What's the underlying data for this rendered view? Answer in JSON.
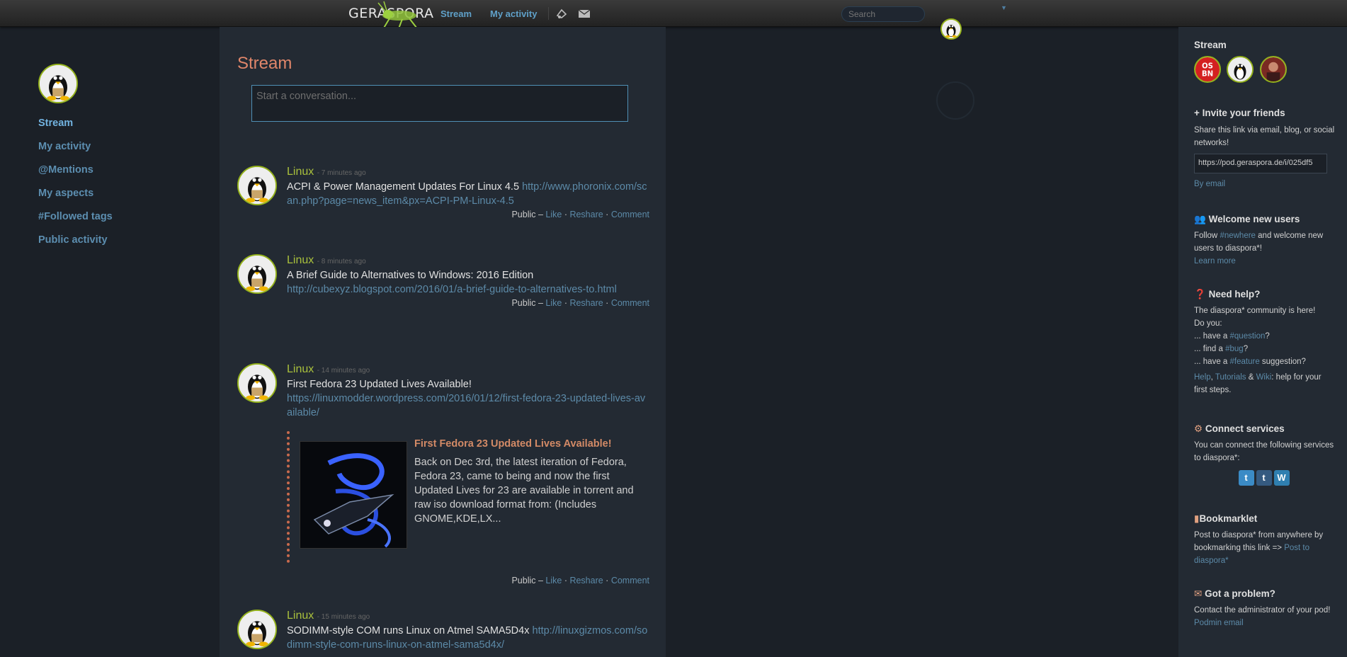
{
  "header": {
    "logo_text": "GERASPORA",
    "nav_stream": "Stream",
    "nav_activity": "My activity",
    "search_placeholder": "Search",
    "icons": [
      "notifications-icon",
      "messages-icon",
      "user-menu-caret-icon"
    ]
  },
  "left_nav": {
    "items": [
      {
        "label": "Stream",
        "active": true
      },
      {
        "label": "My activity"
      },
      {
        "label": "@Mentions"
      },
      {
        "label": "My aspects"
      },
      {
        "label": "#Followed tags"
      },
      {
        "label": "Public activity"
      }
    ]
  },
  "main": {
    "title": "Stream",
    "publisher_placeholder": "Start a conversation...",
    "posts": [
      {
        "author": "Linux",
        "time": "- 7 minutes ago",
        "text": "ACPI & Power Management Updates For Linux 4.5",
        "link": "http://www.phoronix.com/scan.php?page=news_item&px=ACPI-PM-Linux-4.5",
        "visibility": "Public",
        "like": "Like",
        "reshare": "Reshare",
        "comment": "Comment"
      },
      {
        "author": "Linux",
        "time": "- 8 minutes ago",
        "text": "A Brief Guide to Alternatives to Windows: 2016 Edition",
        "link": "http://cubexyz.blogspot.com/2016/01/a-brief-guide-to-alternatives-to.html",
        "visibility": "Public",
        "like": "Like",
        "reshare": "Reshare",
        "comment": "Comment"
      },
      {
        "author": "Linux",
        "time": "- 14 minutes ago",
        "text": "First Fedora 23 Updated Lives Available!",
        "link": "https://linuxmodder.wordpress.com/2016/01/12/first-fedora-23-updated-lives-available/",
        "embed_title": "First Fedora 23 Updated Lives Available!",
        "embed_desc": "Back on Dec 3rd, the latest iteration of Fedora, Fedora 23, came to being and now the first  Updated Lives for 23  are  available in torrent and raw iso download format from: (Includes GNOME,KDE,LX...",
        "visibility": "Public",
        "like": "Like",
        "reshare": "Reshare",
        "comment": "Comment"
      },
      {
        "author": "Linux",
        "time": "- 15 minutes ago",
        "text": "SODIMM-style COM runs Linux on Atmel SAMA5D4x",
        "link": "http://linuxgizmos.com/sodimm-style-com-runs-linux-on-atmel-sama5d4x/"
      }
    ]
  },
  "right": {
    "stream_heading": "Stream",
    "invite_heading": "+ Invite your friends",
    "invite_text": "Share this link via email, blog, or social networks!",
    "invite_link": "https://pod.geraspora.de/i/025df5",
    "by_email": "By email",
    "welcome_heading": "Welcome new users",
    "welcome_text_1": "Follow ",
    "welcome_tag": "#newhere",
    "welcome_text_2": " and welcome new users to diaspora*!",
    "learn_more": "Learn more",
    "help_heading": "Need help?",
    "help_line1": "The diaspora* community is here!",
    "help_line2": "Do you:",
    "help_q_pre": "... have a ",
    "help_q_tag": "#question",
    "help_q_post": "?",
    "help_b_pre": "... find a ",
    "help_b_tag": "#bug",
    "help_b_post": "?",
    "help_f_pre": "... have a ",
    "help_f_tag": "#feature",
    "help_f_post": " suggestion?",
    "help_link_help": "Help",
    "help_link_tutorials": "Tutorials",
    "help_amp": " & ",
    "help_link_wiki": "Wiki",
    "help_tail": ": help for your first steps.",
    "connect_heading": "Connect services",
    "connect_text": "You can connect the following services to diaspora*:",
    "bookmarklet_heading": "Bookmarklet",
    "bookmarklet_text": "Post to diaspora* from anywhere by bookmarking this link => ",
    "bookmarklet_link": "Post to diaspora*",
    "problem_heading": "Got a problem?",
    "problem_text": "Contact the administrator of your pod!",
    "podmin_email": "Podmin email"
  }
}
